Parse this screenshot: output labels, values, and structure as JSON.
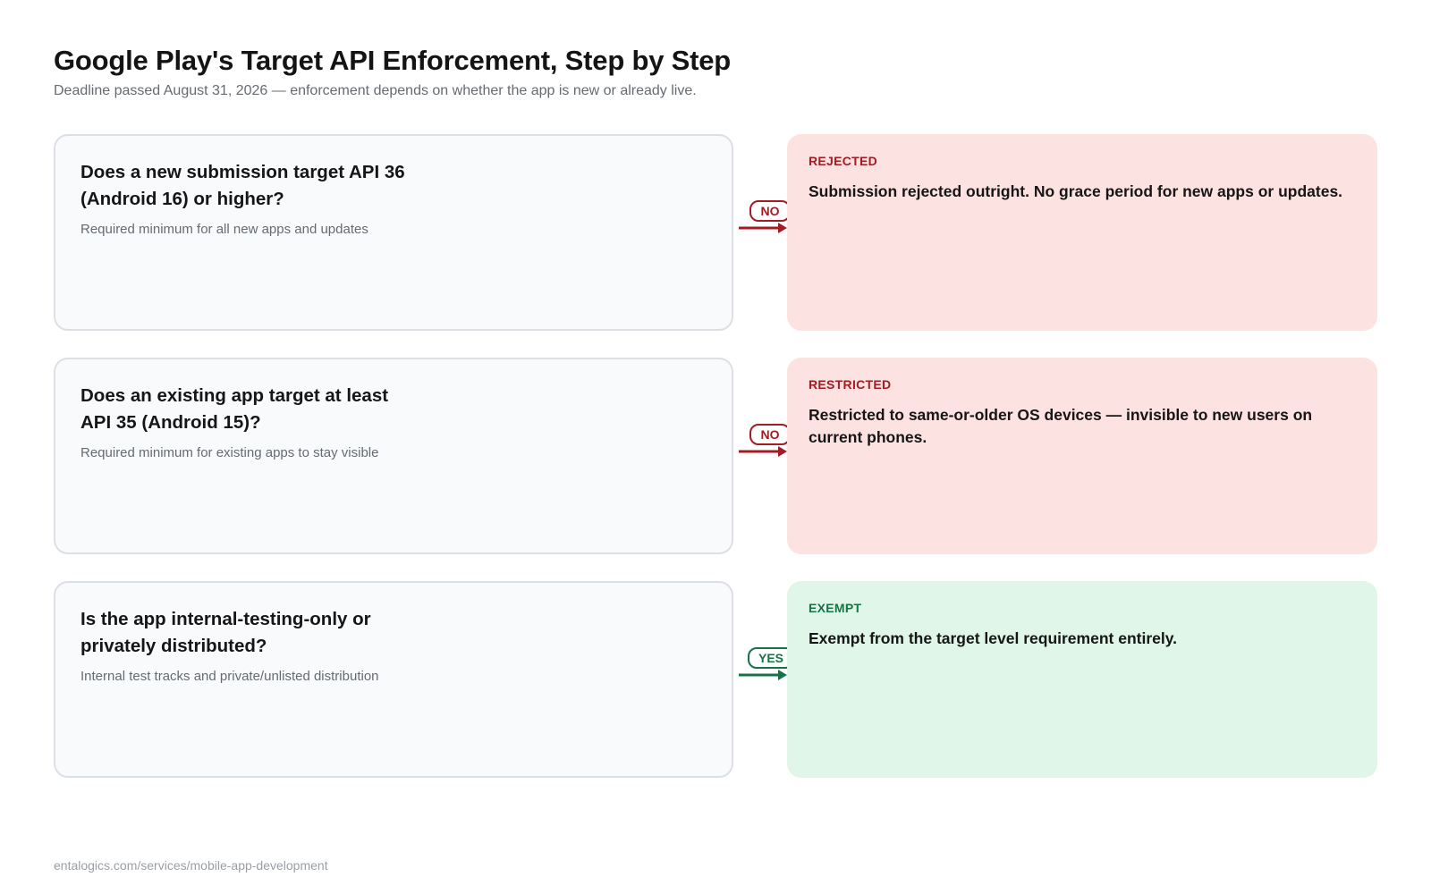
{
  "header": {
    "title": "Google Play's Target API Enforcement, Step by Step",
    "subtitle": "Deadline passed August 31, 2026 — enforcement depends on whether the app is new or already live."
  },
  "steps": [
    {
      "question": "Does a new submission target API 36 (Android 16) or higher?",
      "note": "Required minimum for all new apps and updates",
      "branch_label": "NO",
      "outcome_tag": "REJECTED",
      "outcome_text": "Submission rejected outright. No grace period for new apps or updates."
    },
    {
      "question": "Does an existing app target at least API 35 (Android 15)?",
      "note": "Required minimum for existing apps to stay visible",
      "branch_label": "NO",
      "outcome_tag": "RESTRICTED",
      "outcome_text": "Restricted to same-or-older OS devices — invisible to new users on current phones."
    },
    {
      "question": "Is the app internal-testing-only or privately distributed?",
      "note": "Internal test tracks and private/unlisted distribution",
      "branch_label": "YES",
      "outcome_tag": "EXEMPT",
      "outcome_text": "Exempt from the target level requirement entirely."
    }
  ],
  "colors": {
    "negative": "#a31b23",
    "negative_bg": "#fde2e2",
    "positive": "#177245",
    "positive_bg": "#e0f6e8"
  },
  "footer": {
    "url": "entalogics.com/services/mobile-app-development"
  }
}
